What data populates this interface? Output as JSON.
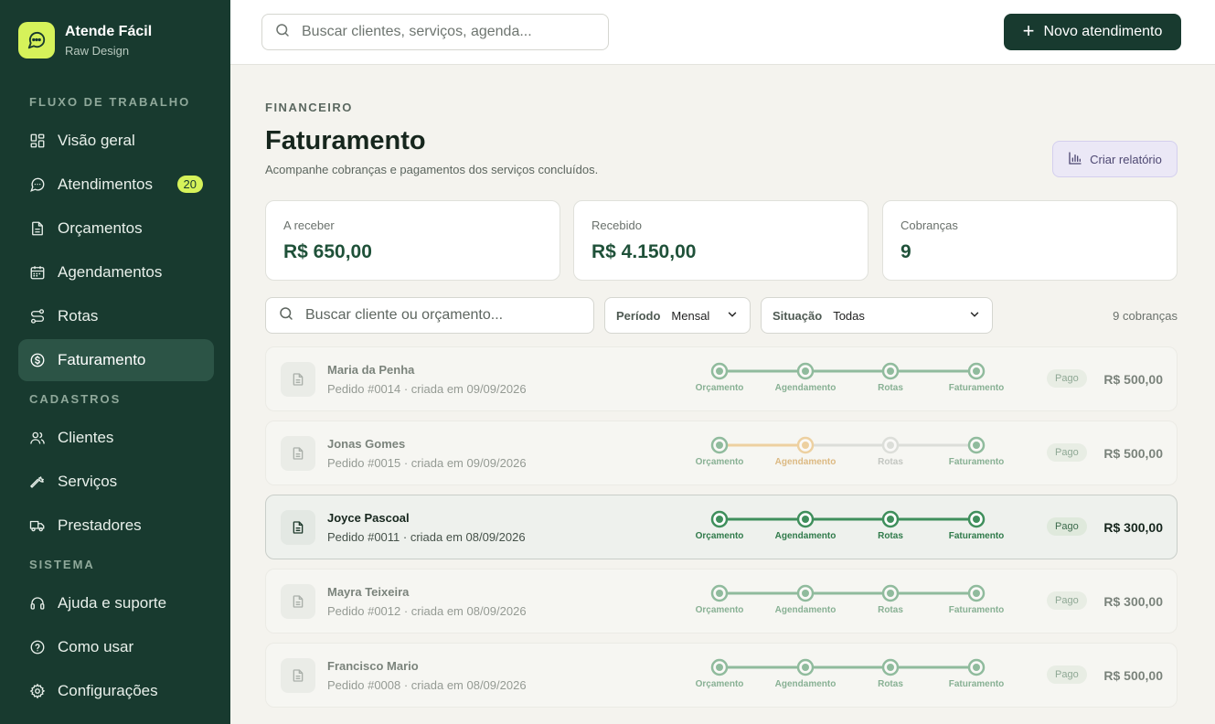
{
  "app": {
    "name": "Atende Fácil",
    "subtitle": "Raw Design"
  },
  "sidebar": {
    "sections": [
      {
        "title": "FLUXO DE TRABALHO",
        "items": [
          {
            "label": "Visão geral",
            "icon": "dashboard-icon"
          },
          {
            "label": "Atendimentos",
            "icon": "chat-icon",
            "badge": "20"
          },
          {
            "label": "Orçamentos",
            "icon": "document-icon"
          },
          {
            "label": "Agendamentos",
            "icon": "calendar-icon"
          },
          {
            "label": "Rotas",
            "icon": "route-icon"
          },
          {
            "label": "Faturamento",
            "icon": "dollar-icon",
            "active": true
          }
        ]
      },
      {
        "title": "CADASTROS",
        "items": [
          {
            "label": "Clientes",
            "icon": "users-icon"
          },
          {
            "label": "Serviços",
            "icon": "wrench-icon"
          },
          {
            "label": "Prestadores",
            "icon": "truck-icon"
          }
        ]
      },
      {
        "title": "SISTEMA",
        "items": [
          {
            "label": "Ajuda e suporte",
            "icon": "headset-icon"
          },
          {
            "label": "Como usar",
            "icon": "help-circle-icon"
          },
          {
            "label": "Configurações",
            "icon": "gear-icon"
          }
        ]
      }
    ]
  },
  "topbar": {
    "search_placeholder": "Buscar clientes, serviços, agenda...",
    "new_button_label": "Novo atendimento"
  },
  "page": {
    "overline": "FINANCEIRO",
    "title": "Faturamento",
    "subtitle": "Acompanhe cobranças e pagamentos dos serviços concluídos.",
    "report_button": "Criar relatório"
  },
  "summary": [
    {
      "label": "A receber",
      "value": "R$ 650,00"
    },
    {
      "label": "Recebido",
      "value": "R$ 4.150,00"
    },
    {
      "label": "Cobranças",
      "value": "9"
    }
  ],
  "filters": {
    "search_placeholder": "Buscar cliente ou orçamento...",
    "period_label": "Período",
    "period_value": "Mensal",
    "status_label": "Situação",
    "status_value": "Todas",
    "count_text": "9 cobranças"
  },
  "stage_labels": [
    "Orçamento",
    "Agendamento",
    "Rotas",
    "Faturamento"
  ],
  "colors": {
    "stage_done": "#3f8f5c",
    "stage_warning": "#e8b562",
    "stage_pending": "#c9cdc9",
    "accent": "#d6f25a",
    "sidebar": "#183a2f"
  },
  "invoices": [
    {
      "client": "Maria da Penha",
      "order": "Pedido #0014 · criada em 09/09/2026",
      "status": "Pago",
      "amount": "R$ 500,00",
      "stages": [
        "done",
        "done",
        "done",
        "done"
      ],
      "faded": true
    },
    {
      "client": "Jonas Gomes",
      "order": "Pedido #0015 · criada em 09/09/2026",
      "status": "Pago",
      "amount": "R$ 500,00",
      "stages": [
        "done",
        "warning",
        "pending",
        "done"
      ],
      "faded": true
    },
    {
      "client": "Joyce Pascoal",
      "order": "Pedido #0011 · criada em 08/09/2026",
      "status": "Pago",
      "amount": "R$ 300,00",
      "stages": [
        "done",
        "done",
        "done",
        "done"
      ],
      "faded": false
    },
    {
      "client": "Mayra Teixeira",
      "order": "Pedido #0012 · criada em 08/09/2026",
      "status": "Pago",
      "amount": "R$ 300,00",
      "stages": [
        "done",
        "done",
        "done",
        "done"
      ],
      "faded": true
    },
    {
      "client": "Francisco Mario",
      "order": "Pedido #0008 · criada em 08/09/2026",
      "status": "Pago",
      "amount": "R$ 500,00",
      "stages": [
        "done",
        "done",
        "done",
        "done"
      ],
      "faded": true
    }
  ]
}
